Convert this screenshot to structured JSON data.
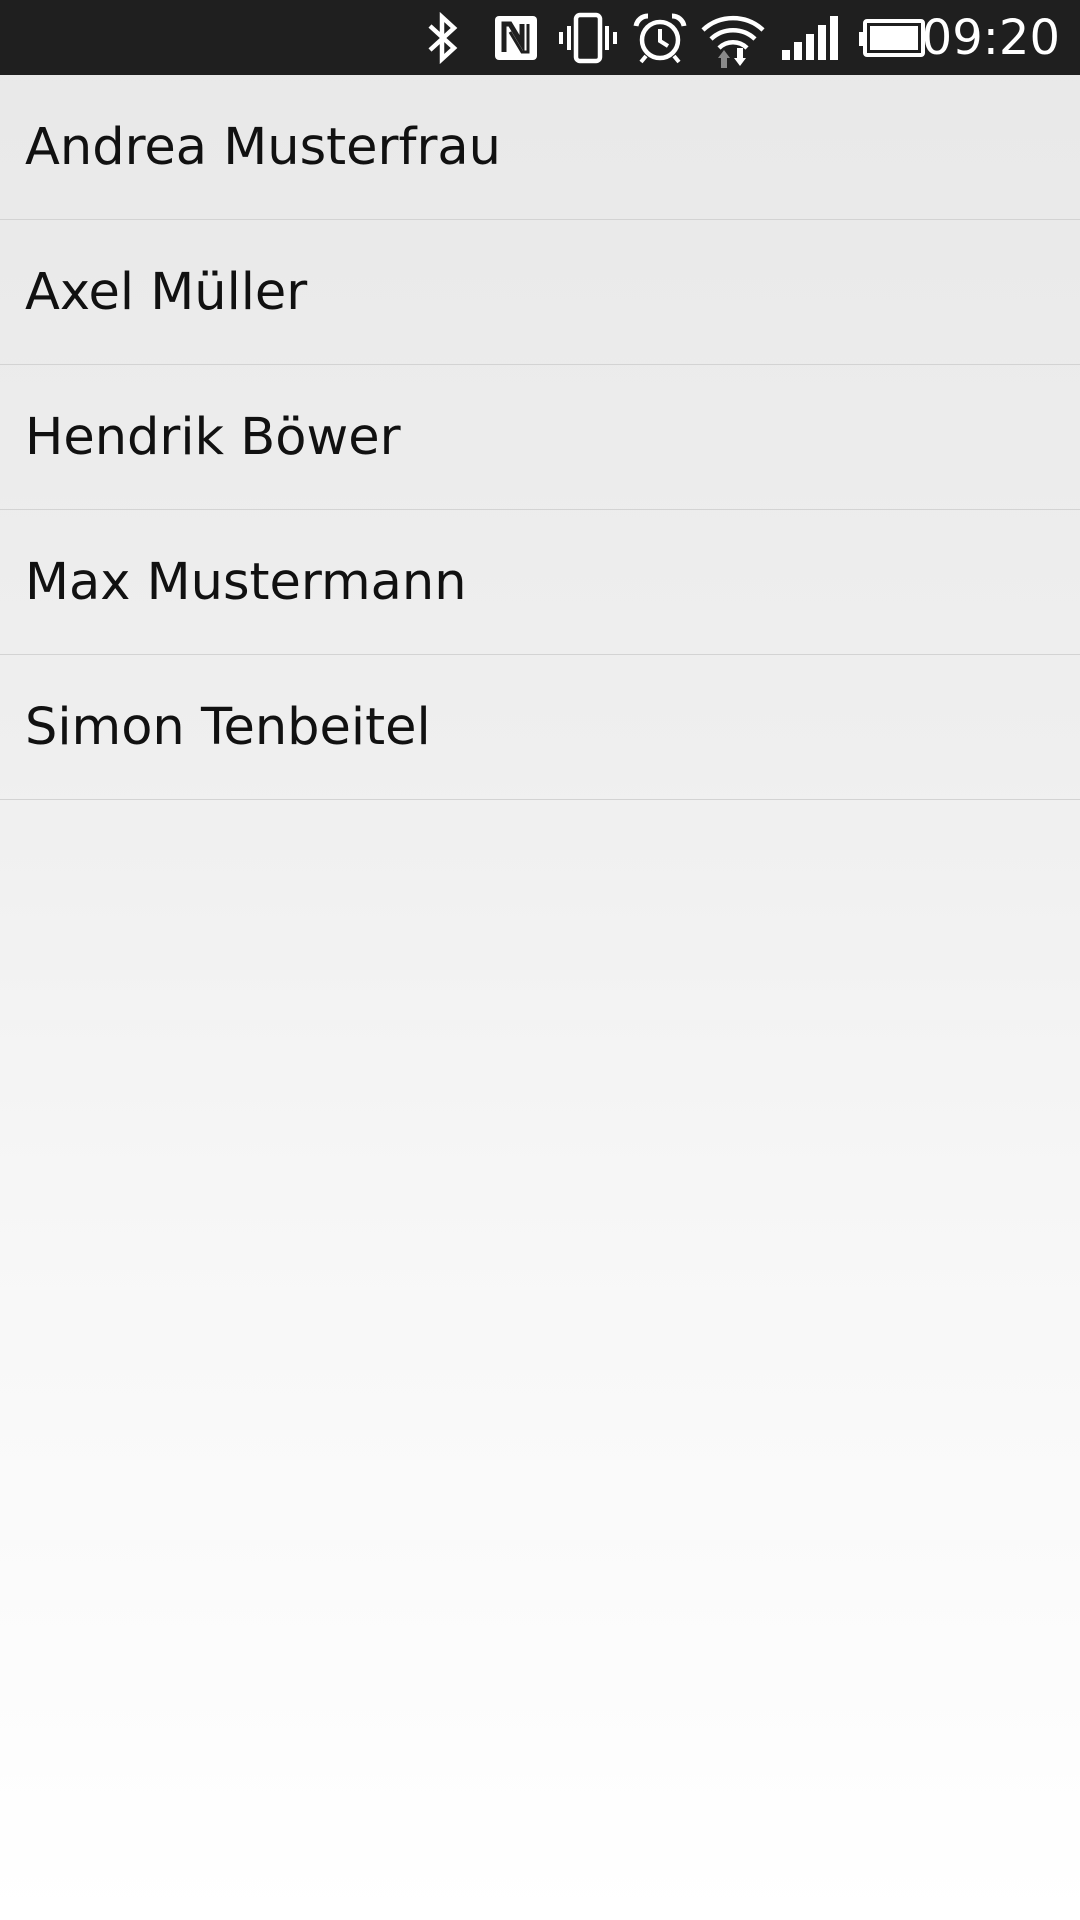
{
  "status_bar": {
    "time": "09:20",
    "icons": [
      "bluetooth-icon",
      "nfc-icon",
      "vibrate-icon",
      "alarm-icon",
      "wifi-icon",
      "signal-icon",
      "battery-icon"
    ],
    "background": "#1f1f1f"
  },
  "contacts": [
    {
      "name": "Andrea Musterfrau"
    },
    {
      "name": "Axel Müller"
    },
    {
      "name": "Hendrik Böwer"
    },
    {
      "name": "Max Mustermann"
    },
    {
      "name": "Simon Tenbeitel"
    }
  ]
}
